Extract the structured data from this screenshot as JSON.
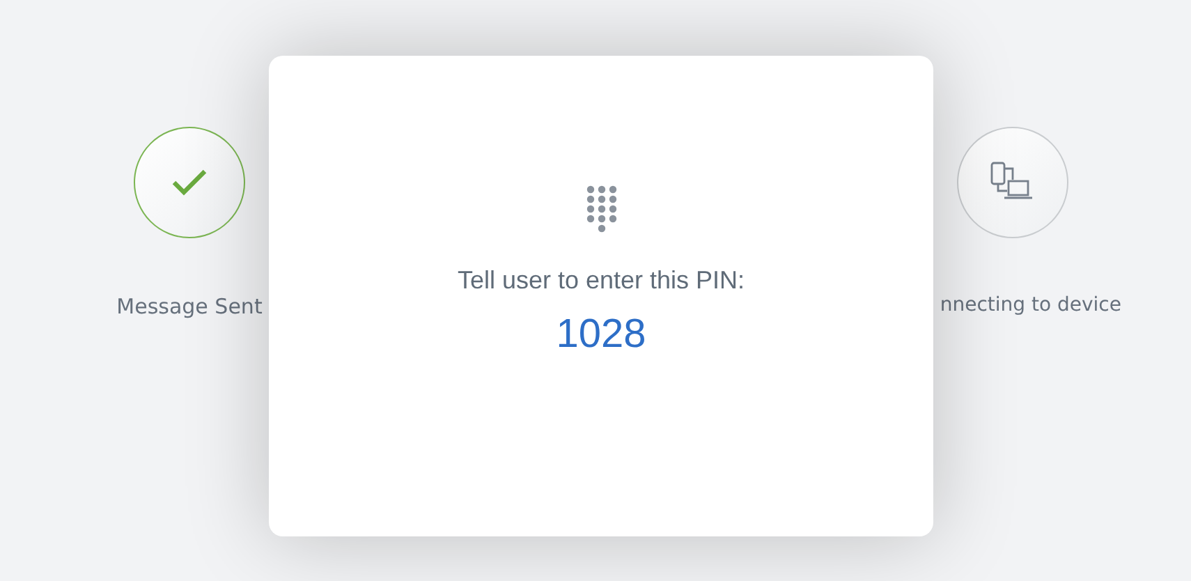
{
  "steps": [
    {
      "kind": "done",
      "label": "Message Sent"
    },
    {
      "kind": "pending",
      "label": "nnecting to device"
    }
  ],
  "dialog": {
    "message": "Tell user to enter this PIN:",
    "pin": "1028"
  }
}
